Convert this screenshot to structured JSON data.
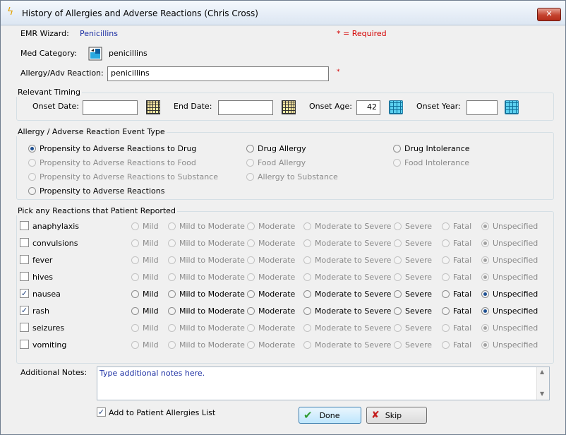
{
  "window": {
    "title": "History of Allergies and Adverse Reactions (Chris Cross)",
    "close_label": "✕"
  },
  "header": {
    "emr_wizard_label": "EMR Wizard:",
    "emr_wizard_value": "Penicillins",
    "required_note": "* = Required",
    "med_category_label": "Med Category:",
    "med_category_value": "penicillins",
    "allergy_label": "Allergy/Adv Reaction:",
    "allergy_value": "penicillins",
    "required_mark": "*"
  },
  "timing": {
    "title": "Relevant Timing",
    "onset_date_label": "Onset Date:",
    "onset_date_value": "",
    "end_date_label": "End Date:",
    "end_date_value": "",
    "onset_age_label": "Onset Age:",
    "onset_age_value": "42",
    "onset_year_label": "Onset Year:",
    "onset_year_value": ""
  },
  "event_type": {
    "title": "Allergy / Adverse Reaction Event Type",
    "options": [
      {
        "label": "Propensity to Adverse Reactions to Drug",
        "selected": true,
        "enabled": true
      },
      {
        "label": "Propensity to Adverse Reactions to Food",
        "selected": false,
        "enabled": false
      },
      {
        "label": "Propensity to Adverse Reactions to Substance",
        "selected": false,
        "enabled": false
      },
      {
        "label": "Propensity to Adverse Reactions",
        "selected": false,
        "enabled": true
      },
      {
        "label": "Drug Allergy",
        "selected": false,
        "enabled": true
      },
      {
        "label": "Food Allergy",
        "selected": false,
        "enabled": false
      },
      {
        "label": "Allergy to Substance",
        "selected": false,
        "enabled": false
      },
      {
        "label": "Drug Intolerance",
        "selected": false,
        "enabled": true
      },
      {
        "label": "Food Intolerance",
        "selected": false,
        "enabled": false
      }
    ]
  },
  "reactions": {
    "title": "Pick any Reactions that Patient Reported",
    "severities": [
      "Mild",
      "Mild to Moderate",
      "Moderate",
      "Moderate to Severe",
      "Severe",
      "Fatal",
      "Unspecified"
    ],
    "rows": [
      {
        "name": "anaphylaxis",
        "checked": false,
        "selected": "Unspecified"
      },
      {
        "name": "convulsions",
        "checked": false,
        "selected": "Unspecified"
      },
      {
        "name": "fever",
        "checked": false,
        "selected": "Unspecified"
      },
      {
        "name": "hives",
        "checked": false,
        "selected": "Unspecified"
      },
      {
        "name": "nausea",
        "checked": true,
        "selected": "Unspecified"
      },
      {
        "name": "rash",
        "checked": true,
        "selected": "Unspecified"
      },
      {
        "name": "seizures",
        "checked": false,
        "selected": "Unspecified"
      },
      {
        "name": "vomiting",
        "checked": false,
        "selected": "Unspecified"
      }
    ]
  },
  "notes": {
    "label": "Additional Notes:",
    "value": "Type additional notes here."
  },
  "footer": {
    "add_to_list_label": "Add to Patient Allergies List",
    "add_to_list_checked": true,
    "done_label": "Done",
    "skip_label": "Skip"
  },
  "colors": {
    "link_blue": "#1c2fa3",
    "required_red": "#d40000",
    "accent_green": "#2e9b2e",
    "close_red": "#c4432f"
  }
}
